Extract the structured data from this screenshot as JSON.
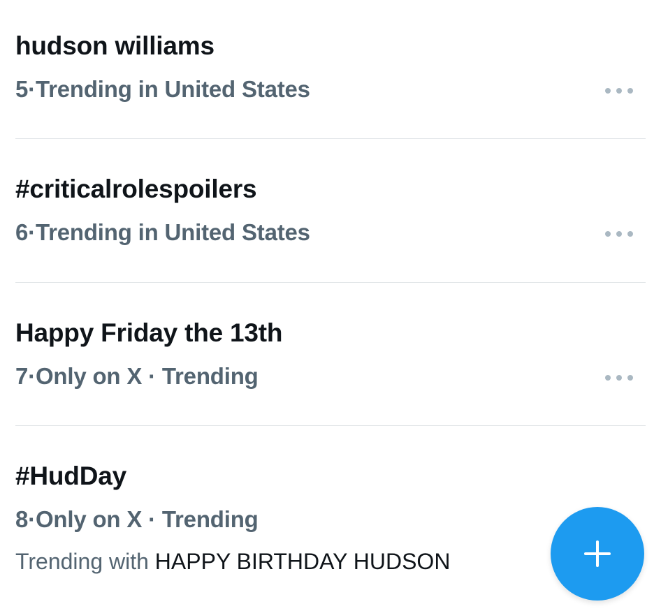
{
  "trends": [
    {
      "title": "hudson williams",
      "rank": "5",
      "separator": "·",
      "meta": "Trending in United States"
    },
    {
      "title": "#criticalrolespoilers",
      "rank": "6",
      "separator": "·",
      "meta": "Trending in United States"
    },
    {
      "title": "Happy Friday the 13th",
      "rank": "7",
      "separator": "·",
      "meta": "Only on X · Trending"
    },
    {
      "title": "#HudDay",
      "rank": "8",
      "separator": "·",
      "meta": "Only on X · Trending",
      "context_prefix": "Trending with",
      "context_value": "HAPPY BIRTHDAY HUDSON"
    }
  ],
  "icons": {
    "more": "more-horizontal-icon",
    "compose": "plus-icon"
  },
  "colors": {
    "title": "#0f1419",
    "meta": "#536471",
    "divider": "#e1e5e8",
    "more_dots": "#aab8c2",
    "accent": "#1d9bf0"
  }
}
